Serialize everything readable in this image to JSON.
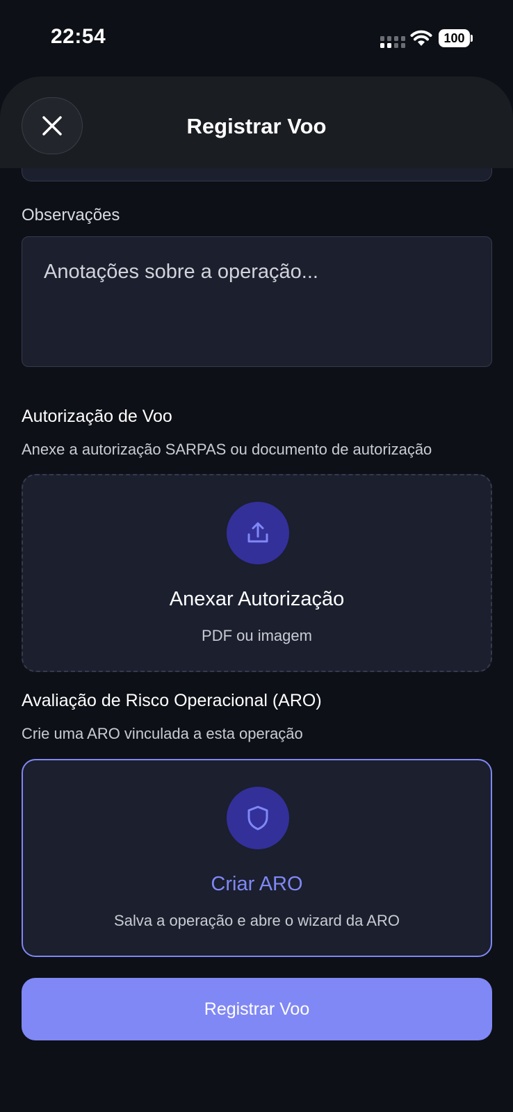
{
  "status_bar": {
    "time": "22:54",
    "battery": "100",
    "icons": [
      "signal-icon",
      "wifi-icon",
      "battery-icon"
    ]
  },
  "header": {
    "title": "Registrar Voo",
    "close_icon": "close-icon"
  },
  "observations": {
    "label": "Observações",
    "placeholder": "Anotações sobre a operação...",
    "value": ""
  },
  "authorization": {
    "title": "Autorização de Voo",
    "description": "Anexe a autorização SARPAS ou documento de autorização",
    "upload_icon": "upload-icon",
    "upload_title": "Anexar Autorização",
    "upload_subtitle": "PDF ou imagem"
  },
  "aro": {
    "title": "Avaliação de Risco Operacional (ARO)",
    "description": "Crie uma ARO vinculada a esta operação",
    "icon": "shield-icon",
    "card_title": "Criar ARO",
    "card_subtitle": "Salva a operação e abre o wizard da ARO"
  },
  "submit": {
    "label": "Registrar Voo"
  },
  "colors": {
    "background": "#0d1016",
    "accent": "#8088f5",
    "card": "#1b1f2e",
    "icon_circle": "#33309a"
  }
}
